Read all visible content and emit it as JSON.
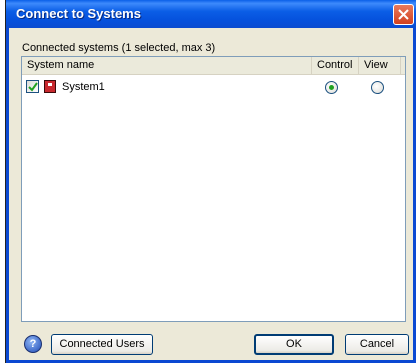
{
  "window": {
    "title": "Connect to Systems"
  },
  "connected_label": "Connected systems (1 selected, max 3)",
  "columns": {
    "name": "System name",
    "control": "Control",
    "view": "View"
  },
  "systems": [
    {
      "name": "System1",
      "checked": true,
      "control": true,
      "view": false
    }
  ],
  "buttons": {
    "connected_users": "Connected Users",
    "ok": "OK",
    "cancel": "Cancel"
  }
}
